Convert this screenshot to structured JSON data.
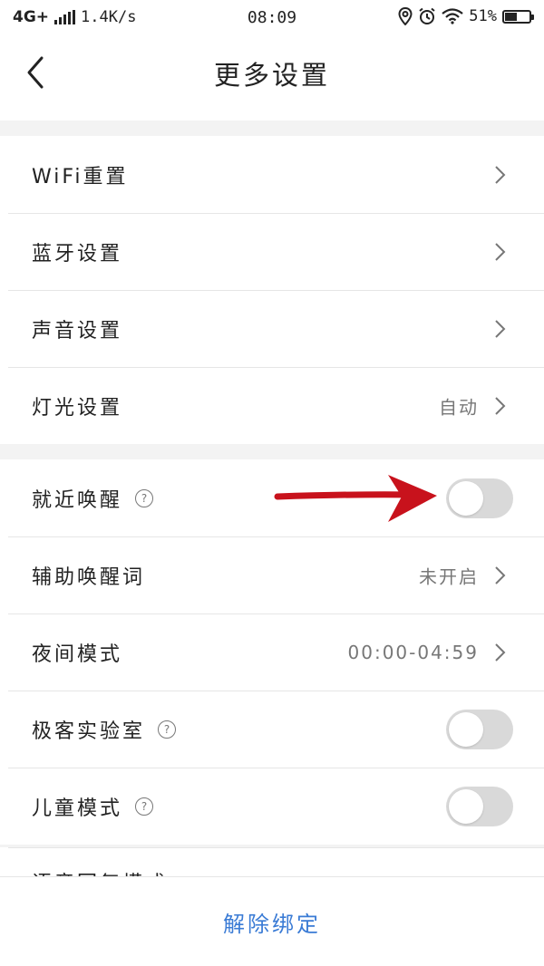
{
  "status_bar": {
    "network": "4G+",
    "speed": "1.4K/s",
    "time": "08:09",
    "battery_percent": "51%",
    "battery_level": 0.51
  },
  "header": {
    "title": "更多设置"
  },
  "group1": [
    {
      "label": "WiFi重置"
    },
    {
      "label": "蓝牙设置"
    },
    {
      "label": "声音设置"
    },
    {
      "label": "灯光设置",
      "value": "自动"
    }
  ],
  "group2": [
    {
      "label": "就近唤醒",
      "help": "?",
      "toggle_on": false
    },
    {
      "label": "辅助唤醒词",
      "value": "未开启"
    },
    {
      "label": "夜间模式",
      "value": "00:00-04:59"
    },
    {
      "label": "极客实验室",
      "help": "?",
      "toggle_on": false
    },
    {
      "label": "儿童模式",
      "help": "?",
      "toggle_on": false
    }
  ],
  "partial_row_label": "语音回复模式",
  "footer": {
    "unbind_label": "解除绑定"
  },
  "colors": {
    "accent": "#3a7bd5",
    "arrow": "#c8121c",
    "toggle_off": "#d9d9d9"
  }
}
